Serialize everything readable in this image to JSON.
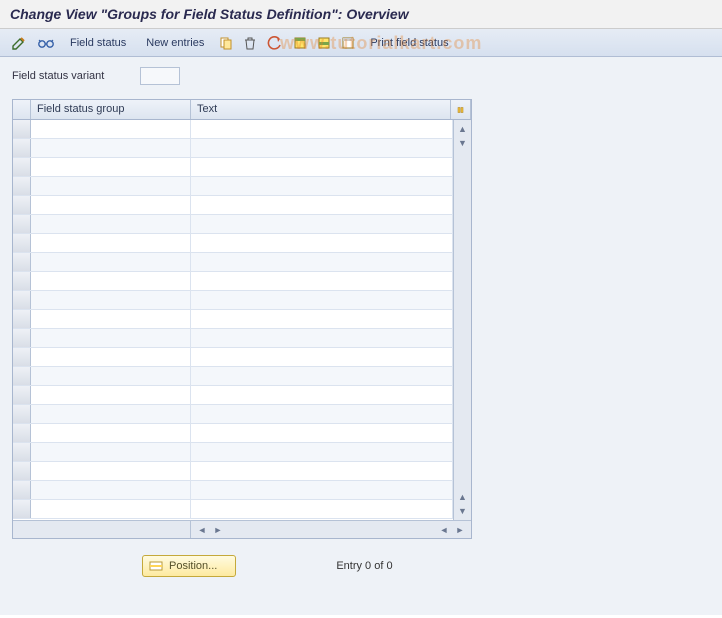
{
  "title": "Change View \"Groups for Field Status Definition\": Overview",
  "toolbar": {
    "field_status_label": "Field status",
    "new_entries_label": "New entries",
    "print_field_status_label": "Print field status"
  },
  "form": {
    "variant_label": "Field status variant",
    "variant_value": ""
  },
  "table": {
    "columns": {
      "group": "Field status group",
      "text": "Text"
    },
    "rows": [
      {
        "group": "",
        "text": ""
      },
      {
        "group": "",
        "text": ""
      },
      {
        "group": "",
        "text": ""
      },
      {
        "group": "",
        "text": ""
      },
      {
        "group": "",
        "text": ""
      },
      {
        "group": "",
        "text": ""
      },
      {
        "group": "",
        "text": ""
      },
      {
        "group": "",
        "text": ""
      },
      {
        "group": "",
        "text": ""
      },
      {
        "group": "",
        "text": ""
      },
      {
        "group": "",
        "text": ""
      },
      {
        "group": "",
        "text": ""
      },
      {
        "group": "",
        "text": ""
      },
      {
        "group": "",
        "text": ""
      },
      {
        "group": "",
        "text": ""
      },
      {
        "group": "",
        "text": ""
      },
      {
        "group": "",
        "text": ""
      },
      {
        "group": "",
        "text": ""
      },
      {
        "group": "",
        "text": ""
      },
      {
        "group": "",
        "text": ""
      },
      {
        "group": "",
        "text": ""
      }
    ]
  },
  "footer": {
    "position_label": "Position...",
    "entry_label": "Entry 0 of 0"
  },
  "watermark": "www.tutorialkart.com"
}
